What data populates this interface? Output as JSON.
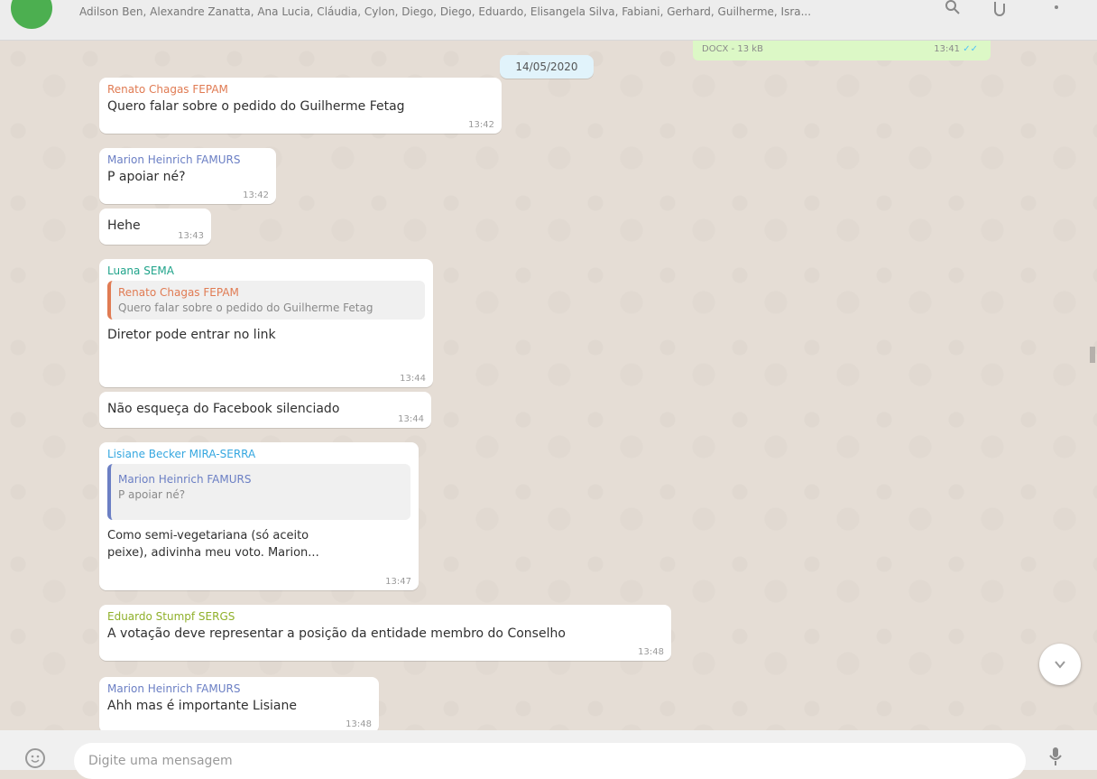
{
  "header": {
    "participants": "Adilson Ben, Alexandre Zanatta, Ana Lucia, Cláudia, Cylon, Diego, Diego, Eduardo, Elisangela Silva, Fabiani, Gerhard, Guilherme, Isra...",
    "search_icon": "search-icon",
    "attach_icon": "paperclip-icon",
    "menu_icon": "more-vertical-icon"
  },
  "outgoing_doc": {
    "info": "DOCX - 13 kB",
    "time": "13:41",
    "tick": "✓✓"
  },
  "date_label": "14/05/2020",
  "messages": [
    {
      "sender": "Renato Chagas FEPAM",
      "text": "Quero falar sobre o pedido do Guilherme Fetag",
      "time": "13:42"
    },
    {
      "sender": "Marion Heinrich FAMURS",
      "text": "P apoiar né?",
      "time": "13:42"
    },
    {
      "text": "Hehe",
      "time": "13:43"
    },
    {
      "sender": "Luana SEMA",
      "quote_sender": "Renato Chagas FEPAM",
      "quote_text": "Quero falar sobre o pedido do Guilherme Fetag",
      "text": "Diretor pode entrar no link",
      "time": "13:44"
    },
    {
      "text": "Não esqueça do Facebook silenciado",
      "time": "13:44"
    },
    {
      "sender": "Lisiane Becker MIRA-SERRA",
      "quote_sender": "Marion Heinrich FAMURS",
      "quote_text": "P apoiar né?",
      "text": "Como semi-vegetariana (só aceito peixe), adivinha meu voto. Marion...",
      "time": "13:47"
    },
    {
      "sender": "Eduardo Stumpf SERGS",
      "text": "A votação deve representar a posição da entidade membro do Conselho",
      "time": "13:48"
    },
    {
      "sender": "Marion Heinrich FAMURS",
      "text": "Ahh mas é importante Lisiane",
      "time": "13:48"
    }
  ],
  "colors": {
    "renato": "#e07b53",
    "marion": "#6b7fc4",
    "luana": "#1fa38a",
    "lisiane": "#35a7e0",
    "eduardo": "#8fb02a",
    "chat_bg": "#e5ddd5",
    "outgoing": "#dcf8c6"
  },
  "footer": {
    "placeholder": "Digite uma mensagem",
    "emoji_icon": "emoji-icon",
    "mic_icon": "microphone-icon"
  },
  "scroll_down_icon": "chevron-down-icon"
}
